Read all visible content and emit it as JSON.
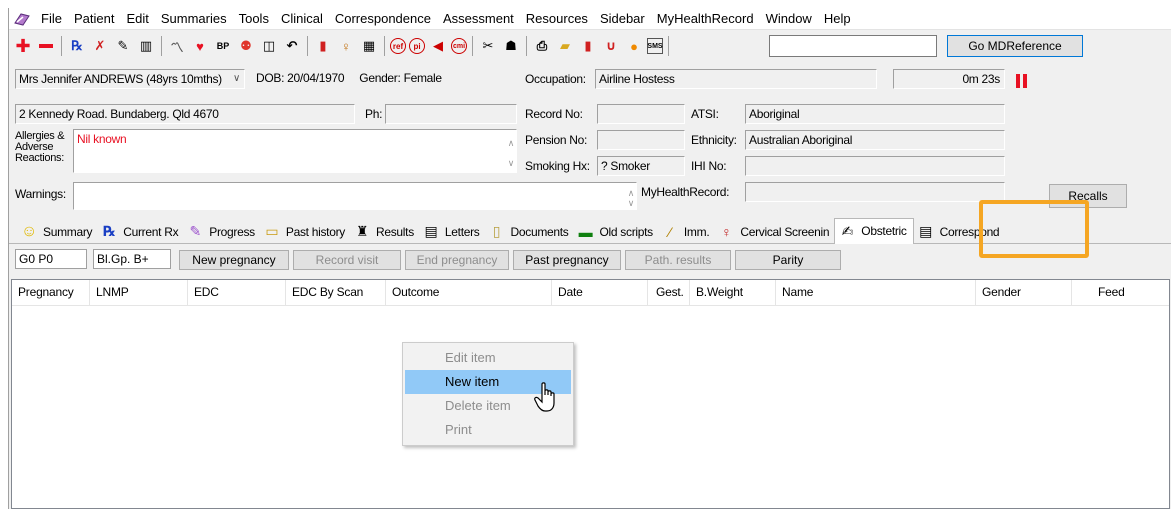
{
  "menu": [
    "File",
    "Patient",
    "Edit",
    "Summaries",
    "Tools",
    "Clinical",
    "Correspondence",
    "Assessment",
    "Resources",
    "Sidebar",
    "MyHealthRecord",
    "Window",
    "Help"
  ],
  "toolbar": {
    "search_value": "",
    "go_label": "Go MDReference"
  },
  "patient": {
    "name": "Mrs Jennifer ANDREWS (48yrs 10mths)",
    "dob": "DOB: 20/04/1970",
    "gender": "Gender: Female",
    "occupation_label": "Occupation:",
    "occupation": "Airline Hostess",
    "timer": "0m 23s",
    "address": "2 Kennedy Road. Bundaberg. Qld  4670",
    "ph_label": "Ph:",
    "ph": "",
    "record_label": "Record No:",
    "record": "",
    "atsi_label": "ATSI:",
    "atsi": "Aboriginal",
    "allergies_label": "Allergies & Adverse Reactions:",
    "allergies": "Nil known",
    "pension_label": "Pension No:",
    "pension": "",
    "ethnicity_label": "Ethnicity:",
    "ethnicity": "Australian Aboriginal",
    "smoking_label": "Smoking Hx:",
    "smoking": "? Smoker",
    "ihi_label": "IHI No:",
    "ihi": "",
    "warnings_label": "Warnings:",
    "warnings": "",
    "mhr_label": "MyHealthRecord:",
    "mhr": "",
    "recalls_label": "Recalls"
  },
  "tabs": {
    "summary": "Summary",
    "current_rx": "Current Rx",
    "progress": "Progress",
    "past_history": "Past history",
    "results": "Results",
    "letters": "Letters",
    "documents": "Documents",
    "old_scripts": "Old scripts",
    "imm": "Imm.",
    "cervical": "Cervical Screenin",
    "obstetric": "Obstetric",
    "correspond": "Correspond"
  },
  "obstetric": {
    "gp": "G0 P0",
    "blood_group": "Bl.Gp. B+",
    "buttons": {
      "new_pregnancy": "New pregnancy",
      "record_visit": "Record visit",
      "end_pregnancy": "End pregnancy",
      "past_pregnancy": "Past pregnancy",
      "path_results": "Path. results",
      "parity": "Parity"
    },
    "columns": [
      "Pregnancy",
      "LNMP",
      "EDC",
      "EDC By Scan",
      "Outcome",
      "Date",
      "Gest.",
      "B.Weight",
      "Name",
      "Gender",
      "Feed"
    ]
  },
  "context_menu": {
    "edit": "Edit item",
    "new": "New item",
    "delete": "Delete item",
    "print": "Print"
  },
  "colors": {
    "highlight": "#f5a623",
    "menu_hover": "#91c9f7",
    "allergy_text": "#e81123"
  }
}
